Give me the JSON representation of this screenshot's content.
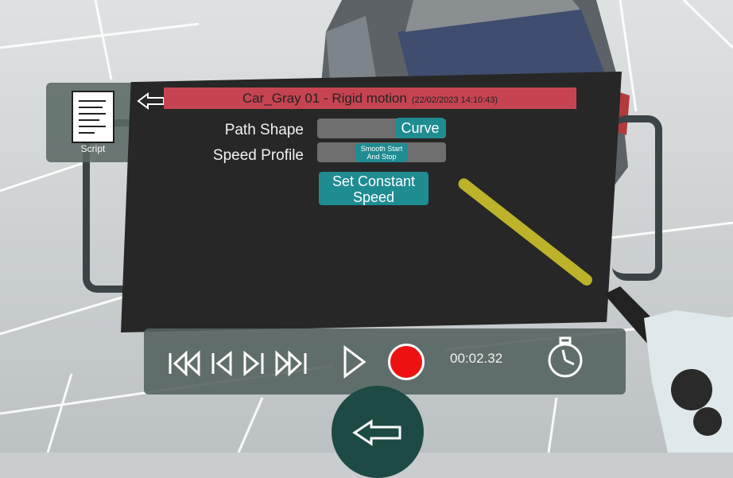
{
  "script_tab": {
    "label": "Script"
  },
  "panel": {
    "title": "Car_Gray 01 - Rigid motion",
    "timestamp": "(22/02/2023 14:10:43)",
    "path_shape": {
      "label": "Path Shape",
      "value": "Curve"
    },
    "speed_profile": {
      "label": "Speed Profile",
      "value_line1": "Smooth Start",
      "value_line2": "And Stop"
    },
    "constant_speed_button": {
      "line1": "Set Constant",
      "line2": "Speed"
    }
  },
  "playback": {
    "time": "00:02.32"
  },
  "colors": {
    "title_bar": "#c64452",
    "accent": "#1f8c92",
    "panel": "#272727",
    "record": "#ee1111"
  },
  "icons": [
    "script-document-icon",
    "back-arrow-icon",
    "skip-to-start-icon",
    "step-back-icon",
    "step-forward-icon",
    "skip-to-end-icon",
    "play-icon",
    "record-icon",
    "stopwatch-icon",
    "round-back-arrow-icon"
  ]
}
